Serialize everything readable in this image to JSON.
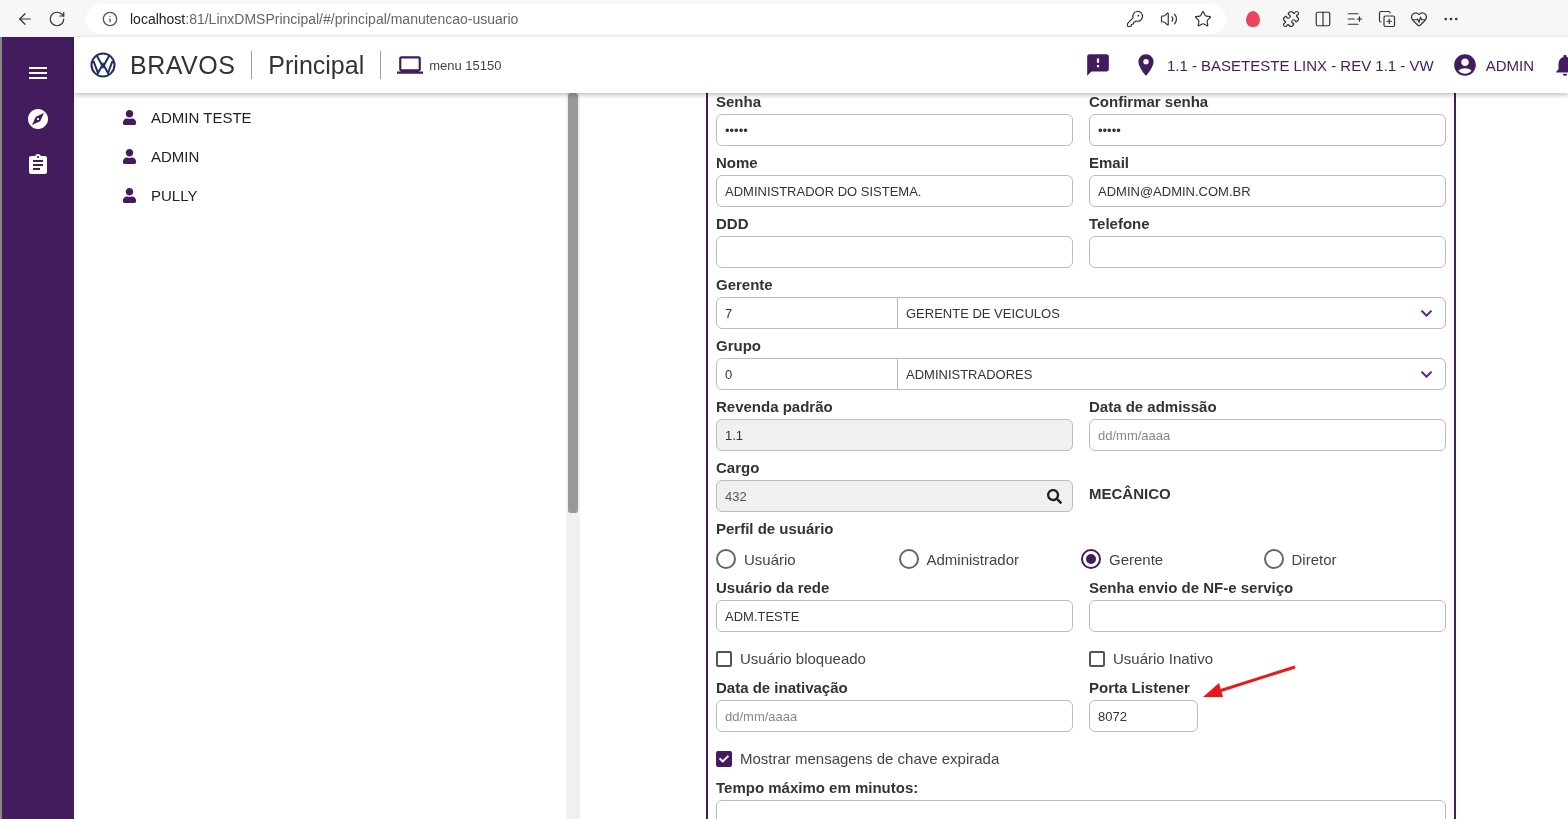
{
  "browser": {
    "url_host": "localhost",
    "url_path": ":81/LinxDMSPrincipal/#/principal/manutencao-usuario"
  },
  "header": {
    "brand": "BRAVOS",
    "module": "Principal",
    "menu": "menu 15150",
    "location": "1.1 - BASETESTE LINX - REV 1.1 - VW",
    "user": "ADMIN"
  },
  "users": [
    "ADMIN TESTE",
    "ADMIN",
    "PULLY"
  ],
  "form": {
    "rows": [
      [
        {
          "kind": "text",
          "label": "Senha",
          "value": "•••••",
          "disabled": false
        },
        {
          "kind": "text",
          "label": "Confirmar senha",
          "value": "•••••",
          "disabled": false
        }
      ],
      [
        {
          "kind": "text",
          "label": "Nome",
          "value": "ADMINISTRADOR DO SISTEMA.",
          "disabled": false
        },
        {
          "kind": "text",
          "label": "Email",
          "value": "ADMIN@ADMIN.COM.BR",
          "disabled": false
        }
      ],
      [
        {
          "kind": "text",
          "label": "DDD",
          "disabled": false
        },
        {
          "kind": "text",
          "label": "Telefone",
          "disabled": false
        }
      ],
      [
        {
          "kind": "select",
          "label": "Gerente",
          "code": "7",
          "value": "GERENTE DE VEICULOS"
        }
      ],
      [
        {
          "kind": "select",
          "label": "Grupo",
          "code": "0",
          "value": "ADMINISTRADORES"
        }
      ],
      [
        {
          "kind": "text",
          "label": "Revenda padrão",
          "value": "1.1",
          "disabled": true
        },
        {
          "kind": "text",
          "label": "Data de admissão",
          "placeholder": "dd/mm/aaaa",
          "disabled": false
        }
      ],
      [
        {
          "kind": "search",
          "label": "Cargo",
          "value": "432",
          "disabled": true
        },
        {
          "kind": "static",
          "text": "MECÂNICO"
        }
      ],
      [
        {
          "kind": "radio",
          "label": "Perfil de usuário",
          "options": [
            {
              "label": "Usuário",
              "selected": false
            },
            {
              "label": "Administrador",
              "selected": false
            },
            {
              "label": "Gerente",
              "selected": true
            },
            {
              "label": "Diretor",
              "selected": false
            }
          ]
        }
      ],
      [
        {
          "kind": "text",
          "label": "Usuário da rede",
          "value": "ADM.TESTE",
          "disabled": false
        },
        {
          "kind": "text",
          "label": "Senha envio de NF-e serviço",
          "disabled": false
        }
      ],
      [
        {
          "kind": "checkbox",
          "label": "Usuário bloqueado",
          "checked": false
        },
        {
          "kind": "checkbox",
          "label": "Usuário Inativo",
          "checked": false
        }
      ],
      [
        {
          "kind": "text",
          "label": "Data de inativação",
          "placeholder": "dd/mm/aaaa",
          "disabled": false
        },
        {
          "kind": "short",
          "label": "Porta Listener",
          "value": "8072",
          "disabled": false
        }
      ],
      [
        {
          "kind": "checkbox",
          "label": "Mostrar mensagens de chave expirada",
          "checked": true
        }
      ],
      [
        {
          "kind": "text",
          "label": "Tempo máximo em minutos:",
          "disabled": false
        }
      ]
    ]
  }
}
